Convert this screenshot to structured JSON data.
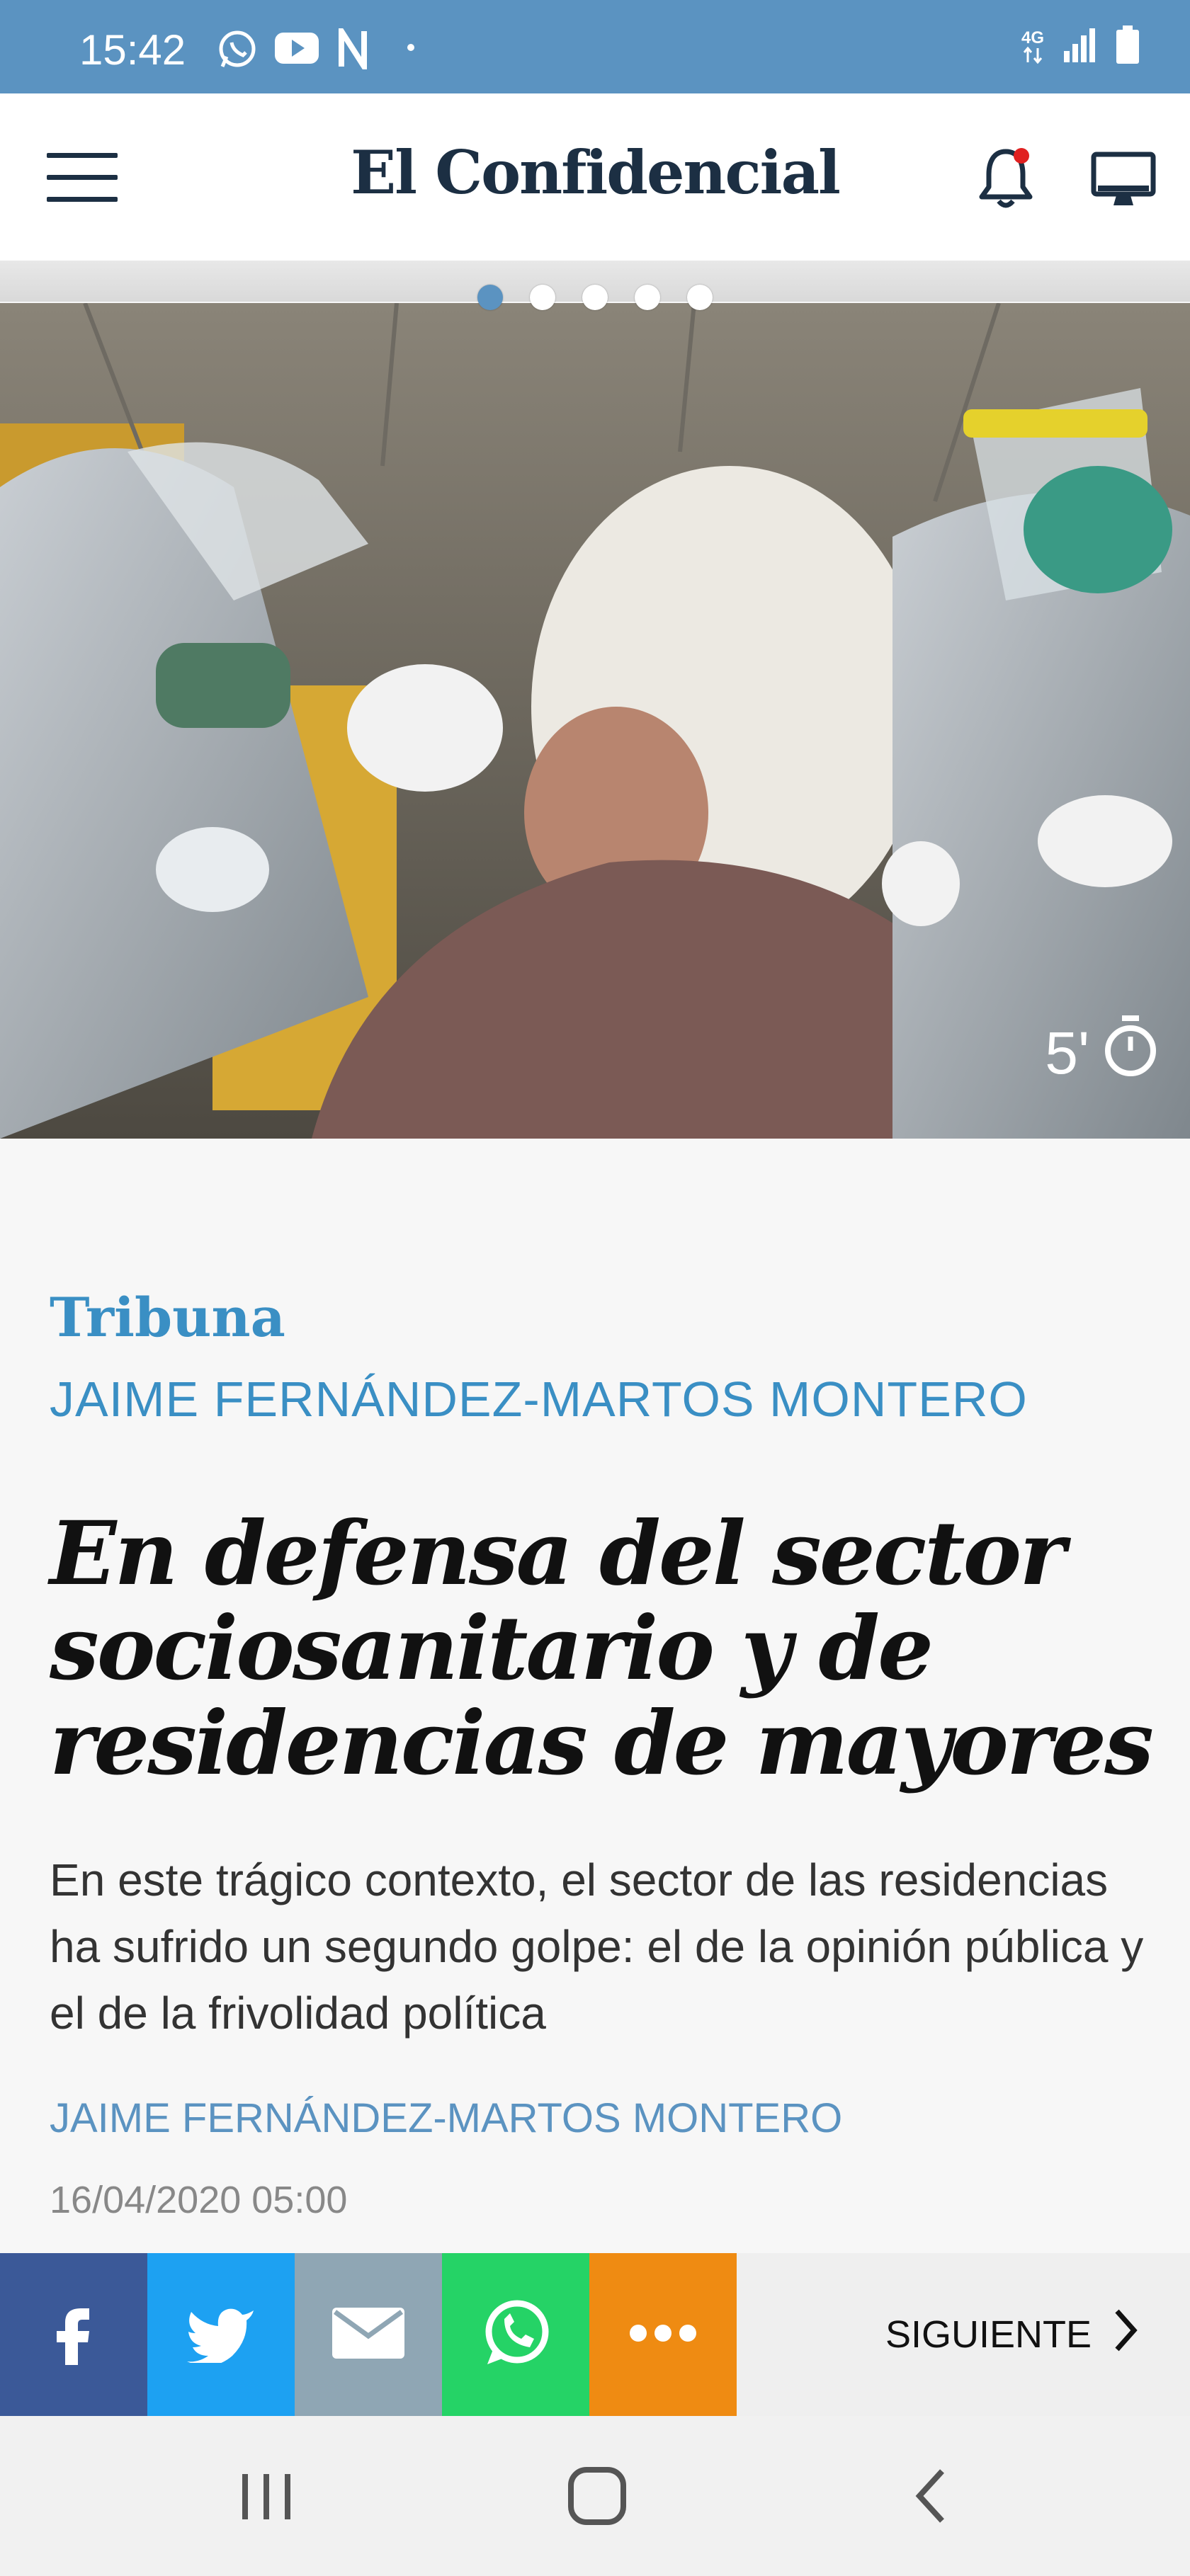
{
  "status_bar": {
    "time": "15:42",
    "icons": [
      "whatsapp-icon",
      "youtube-icon",
      "netflix-icon",
      "dot-icon"
    ],
    "network": "4G",
    "right_icons": [
      "network-4g-icon",
      "signal-icon",
      "battery-icon"
    ]
  },
  "header": {
    "logo": "El Confidencial",
    "notification_dot_color": "#e02020"
  },
  "carousel": {
    "dots": 5,
    "active_index": 0
  },
  "hero": {
    "read_time": "5'",
    "timer_icon": "timer-icon"
  },
  "article": {
    "section": "Tribuna",
    "author_top": "JAIME FERNÁNDEZ-MARTOS MONTERO",
    "headline_lines": [
      "En defensa del sector",
      "sociosanitario y de",
      "residencias de mayores"
    ],
    "subhead": "En este trágico contexto, el sector de las residencias ha sufrido un segundo golpe: el de la opinión pública y el de la frivolidad política",
    "author_bottom": "JAIME FERNÁNDEZ-MARTOS MONTERO",
    "date": "16/04/2020 05:00"
  },
  "share_bar": {
    "buttons": [
      {
        "name": "facebook",
        "icon": "facebook-icon",
        "color": "#3b5998"
      },
      {
        "name": "twitter",
        "icon": "twitter-icon",
        "color": "#1da1f2"
      },
      {
        "name": "email",
        "icon": "mail-icon",
        "color": "#8fa6b4"
      },
      {
        "name": "whatsapp",
        "icon": "whatsapp-icon",
        "color": "#25d366"
      },
      {
        "name": "more",
        "icon": "more-icon",
        "color": "#ef8b12"
      }
    ],
    "next_label": "SIGUIENTE"
  },
  "colors": {
    "status_bar": "#5b93c1",
    "brand_navy": "#1c2f43",
    "section_blue": "#3a8fc4"
  }
}
